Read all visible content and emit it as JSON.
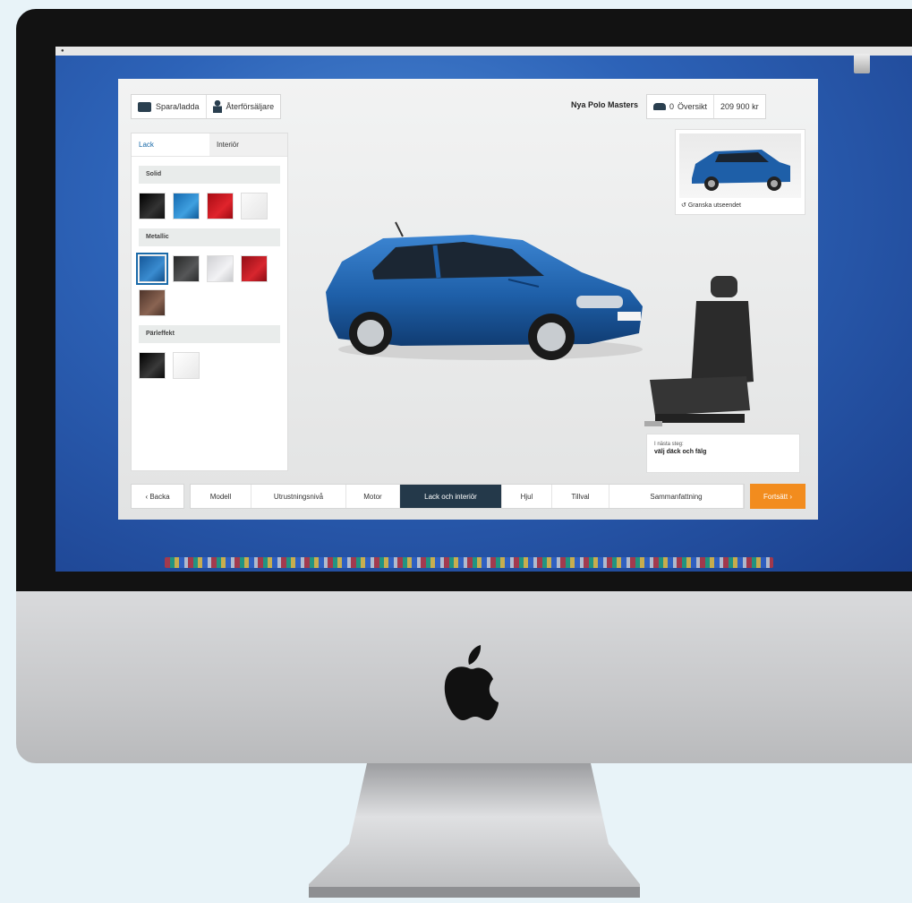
{
  "toolbar": {
    "save_label": "Spara/ladda",
    "dealer_label": "Återförsäljare"
  },
  "header": {
    "model_name": "Nya Polo Masters",
    "cart_count": "0",
    "overview_label": "Översikt",
    "price": "209 900 kr"
  },
  "panel": {
    "tabs": [
      {
        "label": "Lack",
        "active": true
      },
      {
        "label": "Interiör",
        "active": false
      }
    ],
    "sections": [
      {
        "title": "Solid",
        "swatches": [
          "#151515",
          "#1f7fc4",
          "#c4141c",
          "#f2f2f2"
        ]
      },
      {
        "title": "Metallic",
        "swatches": [
          "#1e6fb0",
          "#3a3b3c",
          "#dcdde0",
          "#b8141e",
          "#6b4a3a"
        ]
      },
      {
        "title": "Pärleffekt",
        "swatches": [
          "#121212",
          "#f4f4f4"
        ]
      }
    ],
    "selected_swatch": "#1e6fb0"
  },
  "thumbnail": {
    "label": "Granska utseendet"
  },
  "next_step": {
    "line1": "I nästa steg:",
    "line2": "välj däck och fälg"
  },
  "stepbar": {
    "back_label": "‹ Backa",
    "steps": [
      "Modell",
      "Utrustningsnivå",
      "Motor",
      "Lack och interiör",
      "Hjul",
      "Tillval",
      "Sammanfattning"
    ],
    "current_index": 3,
    "continue_label": "Fortsätt ›"
  },
  "colors": {
    "accent_blue": "#1a6aa8",
    "orange": "#f28c1e",
    "dark_navy": "#24394a",
    "car_blue": "#1e5fa8"
  }
}
